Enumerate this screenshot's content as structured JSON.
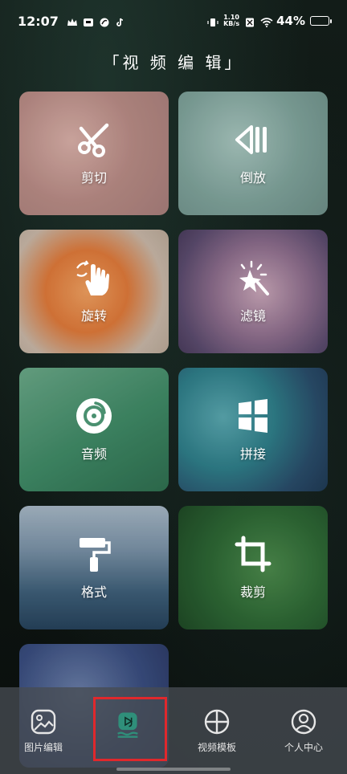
{
  "status_bar": {
    "time": "12:07",
    "net_speed_value": "1.10",
    "net_speed_unit": "KB/s",
    "battery_percent": "44%",
    "battery_level": 0.44
  },
  "page_title": "「视 频 编 辑」",
  "tools": [
    {
      "label": "剪切",
      "icon": "scissors-icon"
    },
    {
      "label": "倒放",
      "icon": "reverse-play-icon"
    },
    {
      "label": "旋转",
      "icon": "rotate-hand-icon"
    },
    {
      "label": "滤镜",
      "icon": "magic-wand-icon"
    },
    {
      "label": "音频",
      "icon": "music-disc-icon"
    },
    {
      "label": "拼接",
      "icon": "windows-grid-icon"
    },
    {
      "label": "格式",
      "icon": "paint-roller-icon"
    },
    {
      "label": "裁剪",
      "icon": "crop-icon"
    }
  ],
  "bottom_nav": [
    {
      "label": "图片编辑",
      "icon": "image-icon"
    },
    {
      "label": "",
      "icon": "video-play-icon",
      "active": true
    },
    {
      "label": "视频模板",
      "icon": "template-grid-icon"
    },
    {
      "label": "个人中心",
      "icon": "user-icon"
    }
  ],
  "colors": {
    "active_tab_accent": "#2f8f7a",
    "highlight_box": "#e0282c"
  }
}
